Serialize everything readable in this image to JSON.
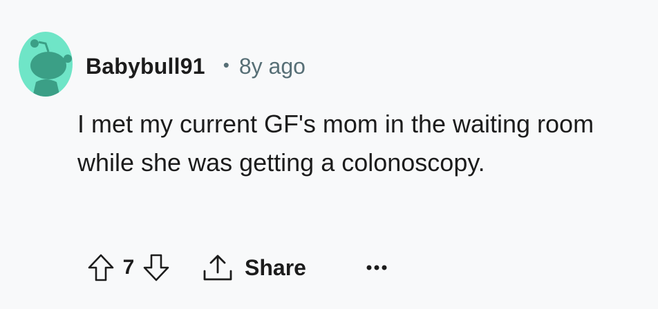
{
  "comment": {
    "author": "Babybull91",
    "separator": "•",
    "time_ago": "8y ago",
    "body": "I met my current GF's mom in the waiting room while she was getting a colonoscopy.",
    "score": "7",
    "share_label": "Share"
  },
  "icons": {
    "avatar": "snoo-avatar",
    "upvote": "upvote-arrow-icon",
    "downvote": "downvote-arrow-icon",
    "share": "share-icon",
    "more": "more-options-icon"
  },
  "colors": {
    "avatar_bg": "#6fe5c7",
    "avatar_figure": "#3b9f86",
    "text_primary": "#1c1c1c",
    "text_meta": "#576f76",
    "icon_stroke": "#1c1c1c",
    "page_bg": "#f8f9fa"
  }
}
